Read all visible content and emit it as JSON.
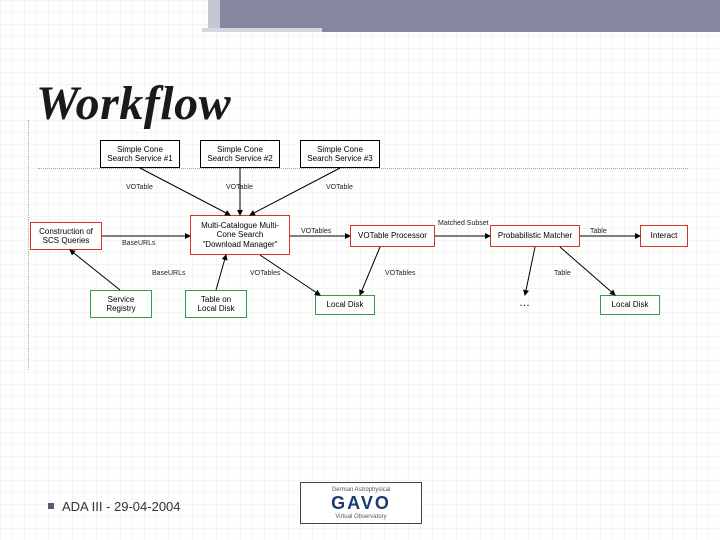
{
  "title": "Workflow",
  "footer": "ADA III - 29-04-2004",
  "logo": {
    "main": "GAVO",
    "sub_top": "German Astrophysical",
    "sub_bottom": "Virtual Observatory"
  },
  "nodes": {
    "scs1": "Simple Cone\nSearch Service #1",
    "scs2": "Simple Cone\nSearch Service #2",
    "scs3": "Simple Cone\nSearch Service #3",
    "queries": "Construction of\nSCS Queries",
    "manager": "Multi-Catalogue Multi-\nCone Search\n\"Download Manager\"",
    "votproc": "VOTable Processor",
    "matcher": "Probabilistic Matcher",
    "interact": "Interact",
    "registry": "Service\nRegistry",
    "localtable": "Table on\nLocal Disk",
    "localdisk1": "Local Disk",
    "localdisk2": "Local Disk"
  },
  "edge_labels": {
    "vot1": "VOTable",
    "vot2": "VOTable",
    "vot3": "VOTable",
    "votables_down": "VOTables",
    "votables_mid1": "VOTables",
    "votables_mid2": "VOTables",
    "baseurls": "BaseURLs",
    "baseurls2": "BaseURLs",
    "matched": "Matched\nSubset",
    "table_r": "Table",
    "table_r2": "Table"
  }
}
